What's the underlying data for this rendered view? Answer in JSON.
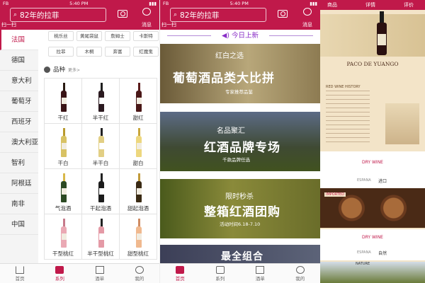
{
  "status": {
    "carrier": "FB",
    "time": "5:40 PM"
  },
  "header": {
    "search_text": "82年的拉菲",
    "scan_label": "扫一扫",
    "msg_label": "消息"
  },
  "countries": [
    "法国",
    "德国",
    "意大利",
    "葡萄牙",
    "西班牙",
    "澳大利亚",
    "智利",
    "阿根廷",
    "南非",
    "中国"
  ],
  "tags": [
    "桃乐丝",
    "黄尾袋鼠",
    "詹姆士",
    "卡斯特",
    "拉菲",
    "木桐",
    "奔富",
    "红魔鬼"
  ],
  "category": {
    "title": "品种",
    "more": "更多>"
  },
  "wines": [
    "干红",
    "半干红",
    "甜红",
    "干白",
    "半干白",
    "甜白",
    "气泡酒",
    "干起泡酒",
    "甜起泡酒",
    "干型桃红",
    "半干型桃红",
    "甜型桃红"
  ],
  "tabs": [
    "首页",
    "系列",
    "酒单",
    "我的"
  ],
  "today_title": "今日上新",
  "banners": [
    {
      "t1": "红白之选",
      "t2": "葡萄酒品类大比拼",
      "t3": "专家推荐品鉴"
    },
    {
      "t1": "名品聚汇",
      "t2": "红酒品牌专场",
      "t3": "千款品牌任选"
    },
    {
      "t1": "限时秒杀",
      "t2": "整箱红酒团购",
      "t3": "活动时间6.18-7.10"
    },
    {
      "t1": "",
      "t2": "最全组合",
      "t3": ""
    }
  ],
  "detail": {
    "header_left": "商品",
    "header_mid": "详情",
    "header_right": "评价",
    "brand": "PACO DE YUANGO",
    "history": "RED WINE HISTORY",
    "dry_wine_1": "DRY WINE",
    "origin_1": "ESPANA",
    "origin_1_cn": "进口",
    "imported": "IMPORTED",
    "dry_wine_2": "DRY WINE",
    "origin_2": "ESPANA",
    "origin_2_cn": "自然",
    "nature": "NATURE"
  }
}
